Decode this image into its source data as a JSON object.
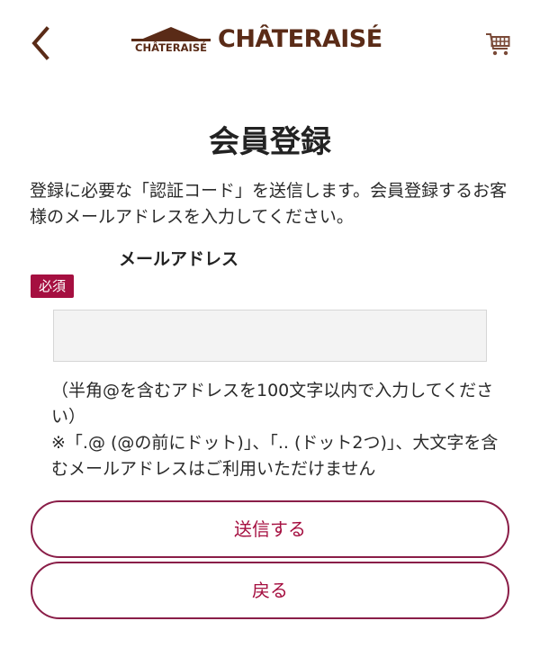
{
  "header": {
    "back_icon": "chevron-left-icon",
    "logo_small": "CHÂTERAISÉ",
    "logo_main": "CHÂTERAISÉ",
    "cart_icon": "cart-icon"
  },
  "page": {
    "title": "会員登録",
    "intro": "登録に必要な「認証コード」を送信します。会員登録するお客様のメールアドレスを入力してください。"
  },
  "form": {
    "email_label": "メールアドレス",
    "required_badge": "必須",
    "email_value": "",
    "email_placeholder": "",
    "note_line1": "（半角@を含むアドレスを100文字以内で入力してください）",
    "note_line2": "※「.@ (@の前にドット)」、「.. (ドット2つ)」、大文字を含むメールアドレスはご利用いただけません"
  },
  "buttons": {
    "send": "送信する",
    "back": "戻る"
  },
  "colors": {
    "brand_brown": "#5a2b17",
    "accent": "#a50f40",
    "button_border": "#8a1e48",
    "input_bg": "#f3f3f3"
  }
}
